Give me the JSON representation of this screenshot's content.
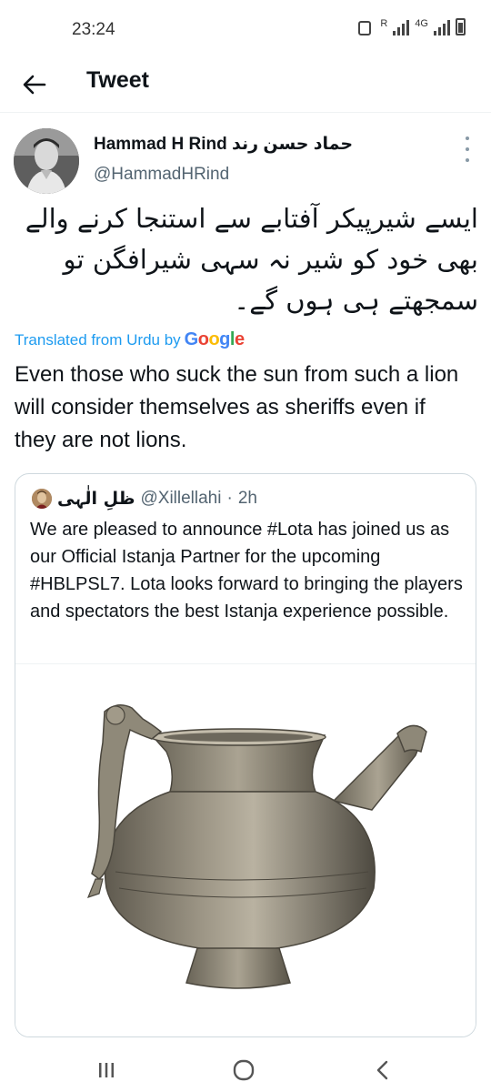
{
  "status_bar": {
    "time": "23:24",
    "network": "4G",
    "sim_label": "R"
  },
  "header": {
    "title": "Tweet",
    "back_icon": "arrow-left-icon"
  },
  "tweet": {
    "display_name": "Hammad H Rind حماد حسن رند",
    "handle": "@HammadHRind",
    "text_urdu": "ایسے شیرپیکر آفتابے سے استنجا کرنے والے بھی خود کو شیر نہ سہی شیرافگن تو سمجھتے ہی ہوں گے۔",
    "translated_label": "Translated from Urdu by",
    "translator_name": "Google",
    "translation": "Even those who suck the sun from such a lion will consider themselves as sheriffs even if they are not lions."
  },
  "quote": {
    "display_name": "ظلِ الٰہی",
    "handle": "@Xillellahi",
    "separator": "·",
    "time": "2h",
    "text": "We are pleased to announce #Lota has joined us as our Official Istanja Partner for the upcoming #HBLPSL7. Lota looks forward to bringing the players and spectators the best Istanja experience possible."
  },
  "colors": {
    "link_blue": "#1d9bf0",
    "secondary_text": "#536471",
    "primary_text": "#0f1419",
    "border": "#cfd9de",
    "google_blue": "#4285f4",
    "google_red": "#ea4335",
    "google_yellow": "#fbbc05",
    "google_green": "#34a853"
  },
  "nav": {
    "recents_icon": "recents-icon",
    "home_icon": "home-circle-icon",
    "back_icon": "chevron-left-icon"
  }
}
